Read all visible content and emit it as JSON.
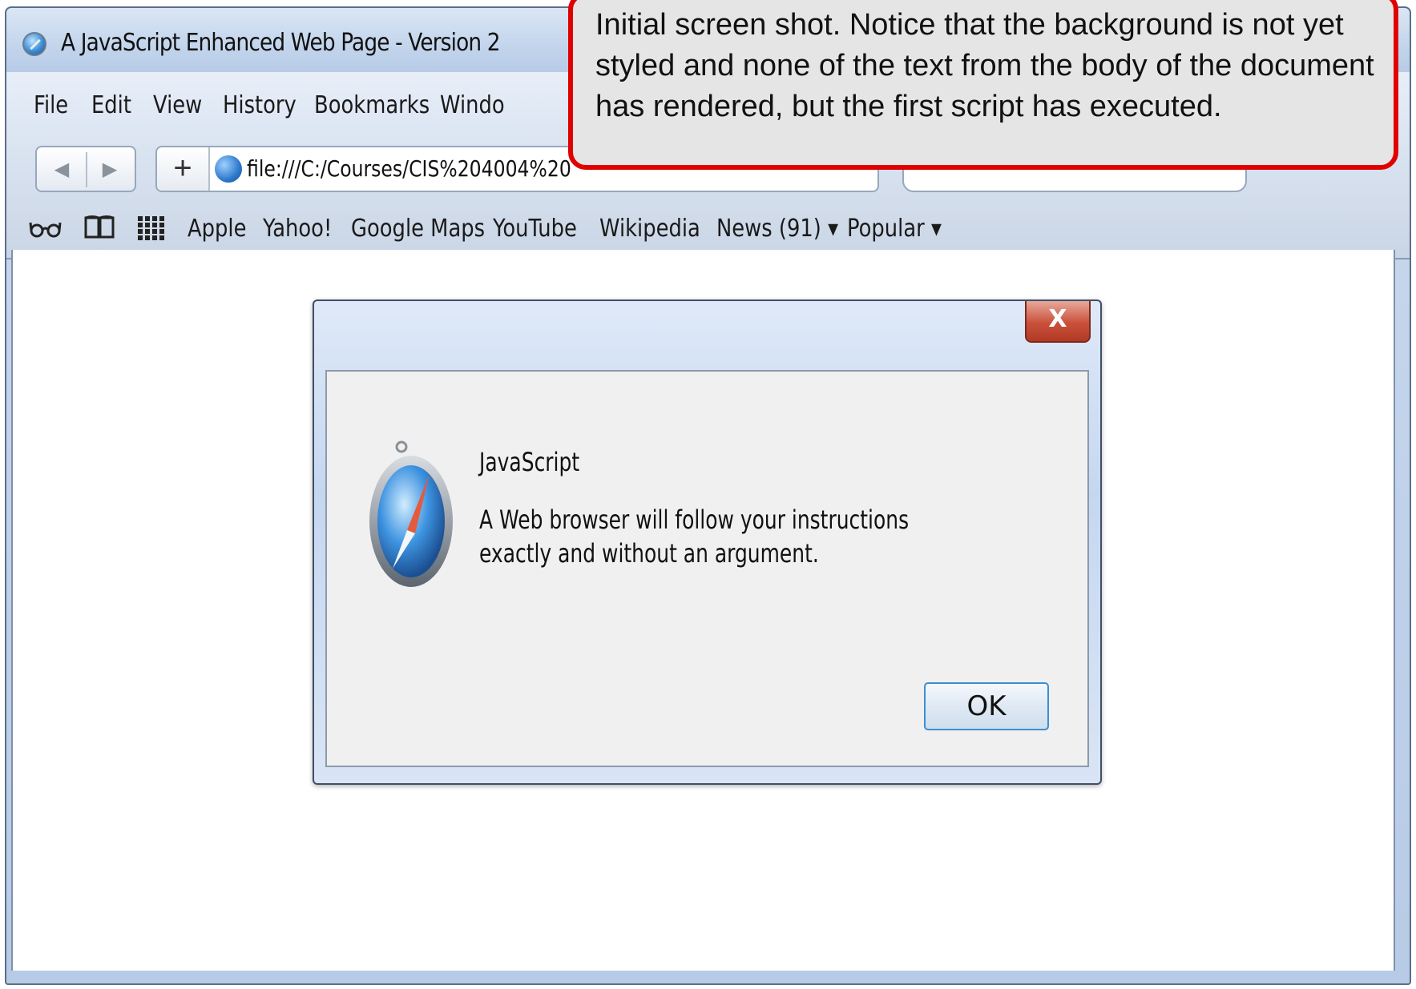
{
  "window": {
    "title": "A JavaScript Enhanced Web Page - Version 2"
  },
  "menubar": {
    "items": [
      "File",
      "Edit",
      "View",
      "History",
      "Bookmarks",
      "Windo"
    ]
  },
  "toolbar": {
    "back_icon": "◀",
    "forward_icon": "▶",
    "add_label": "+",
    "address": "file:///C:/Courses/CIS%204004%20"
  },
  "bookmarks": {
    "icons": [
      "reading-glasses-icon",
      "book-icon",
      "grid-icon"
    ],
    "items": [
      "Apple",
      "Yahoo!",
      "Google Maps",
      "YouTube",
      "Wikipedia",
      "News (91) ▾",
      "Popular ▾"
    ]
  },
  "dialog": {
    "close_label": "X",
    "heading": "JavaScript",
    "message": "A Web browser will follow your instructions exactly and without an argument.",
    "ok_label": "OK"
  },
  "callout": {
    "text": "Initial screen shot.  Notice that the background is not yet styled and none of the text from the body of the document has rendered, but the first script has executed."
  },
  "colors": {
    "callout_border": "#e00000",
    "callout_fill": "#e5e5e5",
    "ok_focus": "#3c8fd0"
  }
}
